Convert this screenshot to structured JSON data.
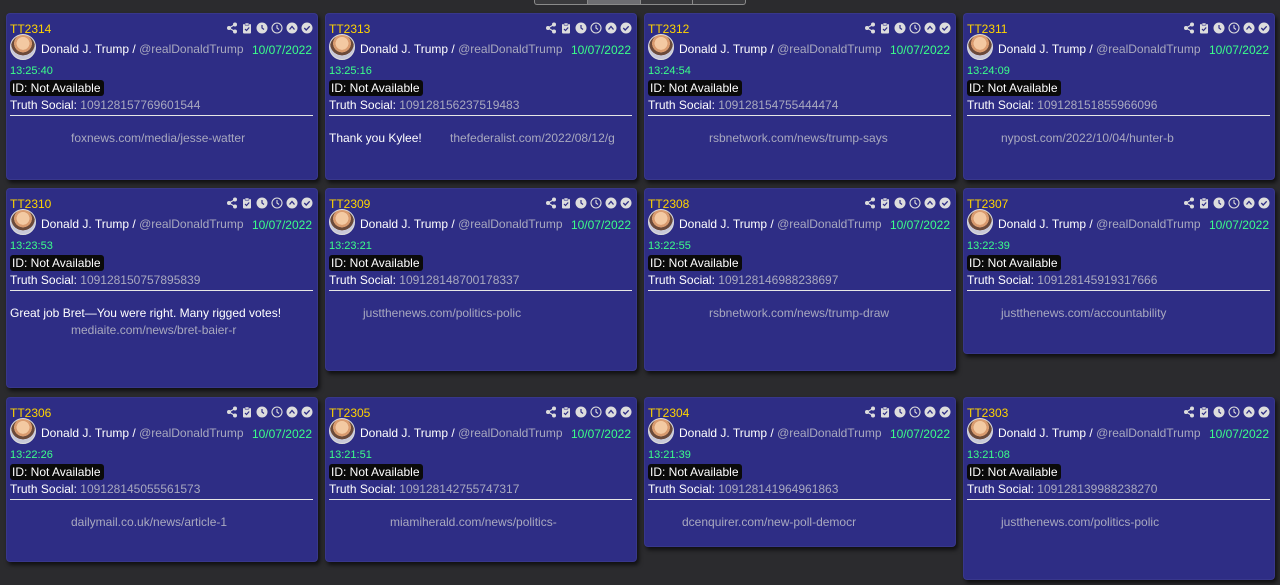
{
  "top_controls": {
    "segments": 4,
    "active_index": 1
  },
  "header": {
    "name": "Donald J. Trump",
    "separator": "/",
    "handle": "@realDonaldTrump",
    "id_badge": "ID: Not Available",
    "truth_label": "Truth Social:"
  },
  "colors": {
    "card_bg": "#2e2d85",
    "page_bg": "#2b2b2e",
    "id_color": "#ffd400",
    "date_color": "#3bff8a"
  },
  "action_icons": [
    "share-icon",
    "clipboard-icon",
    "clock-filled-icon",
    "clock-outline-icon",
    "chevron-up-circle-icon",
    "check-circle-icon"
  ],
  "cards": [
    {
      "id": "TT2314",
      "date": "10/07/2022",
      "time": "13:25:40",
      "truth": "109128157769601544",
      "text": "",
      "link": "foxnews.com/media/jesse-watter"
    },
    {
      "id": "TT2313",
      "date": "10/07/2022",
      "time": "13:25:16",
      "truth": "109128156237519483",
      "text": "Thank you Kylee!",
      "link": "thefederalist.com/2022/08/12/g"
    },
    {
      "id": "TT2312",
      "date": "10/07/2022",
      "time": "13:24:54",
      "truth": "109128154755444474",
      "text": "",
      "link": "rsbnetwork.com/news/trump-says"
    },
    {
      "id": "TT2311",
      "date": "10/07/2022",
      "time": "13:24:09",
      "truth": "109128151855966096",
      "text": "",
      "link": "nypost.com/2022/10/04/hunter-b"
    },
    {
      "id": "TT2310",
      "date": "10/07/2022",
      "time": "13:23:53",
      "truth": "109128150757895839",
      "text": "Great job Bret—You were right. Many rigged votes!",
      "link": "mediaite.com/news/bret-baier-r"
    },
    {
      "id": "TT2309",
      "date": "10/07/2022",
      "time": "13:23:21",
      "truth": "109128148700178337",
      "text": "",
      "link": "justthenews.com/politics-polic"
    },
    {
      "id": "TT2308",
      "date": "10/07/2022",
      "time": "13:22:55",
      "truth": "109128146988238697",
      "text": "",
      "link": "rsbnetwork.com/news/trump-draw"
    },
    {
      "id": "TT2307",
      "date": "10/07/2022",
      "time": "13:22:39",
      "truth": "109128145919317666",
      "text": "",
      "link": "justthenews.com/accountability"
    },
    {
      "id": "TT2306",
      "date": "10/07/2022",
      "time": "13:22:26",
      "truth": "109128145055561573",
      "text": "",
      "link": "dailymail.co.uk/news/article-1"
    },
    {
      "id": "TT2305",
      "date": "10/07/2022",
      "time": "13:21:51",
      "truth": "109128142755747317",
      "text": "",
      "link": "miamiherald.com/news/politics-"
    },
    {
      "id": "TT2304",
      "date": "10/07/2022",
      "time": "13:21:39",
      "truth": "109128141964961863",
      "text": "",
      "link": "dcenquirer.com/new-poll-democr"
    },
    {
      "id": "TT2303",
      "date": "10/07/2022",
      "time": "13:21:08",
      "truth": "109128139988238270",
      "text": "",
      "link": "justthenews.com/politics-polic"
    }
  ]
}
